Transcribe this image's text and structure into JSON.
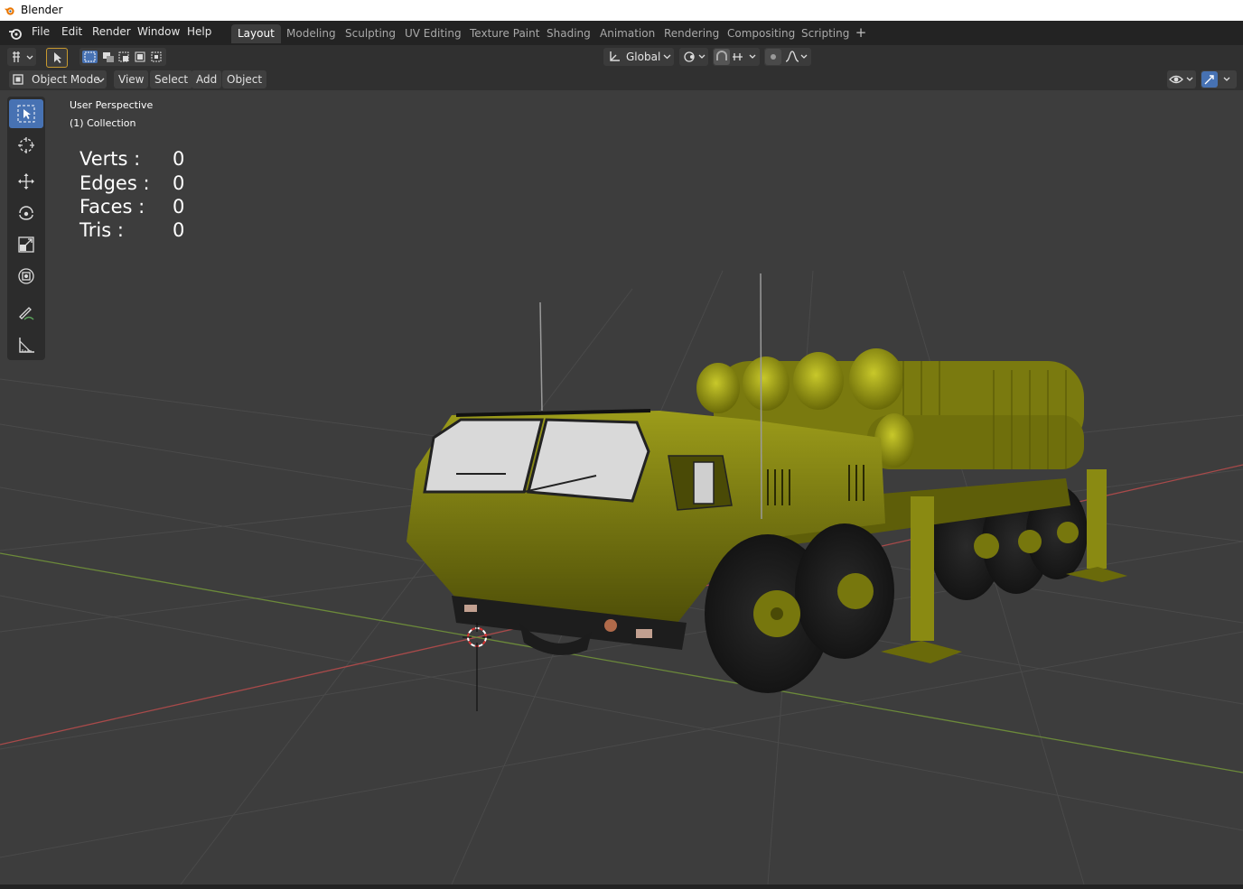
{
  "window": {
    "title": "Blender"
  },
  "menu": {
    "file": "File",
    "edit": "Edit",
    "render": "Render",
    "window": "Window",
    "help": "Help"
  },
  "workspaces": [
    "Layout",
    "Modeling",
    "Sculpting",
    "UV Editing",
    "Texture Paint",
    "Shading",
    "Animation",
    "Rendering",
    "Compositing",
    "Scripting"
  ],
  "active_workspace": "Layout",
  "header": {
    "orientation": "Global"
  },
  "viewport_header": {
    "mode": "Object Mode",
    "view": "View",
    "select": "Select",
    "add": "Add",
    "object": "Object"
  },
  "overlay": {
    "perspective": "User Perspective",
    "collection": "(1) Collection"
  },
  "stats": {
    "verts_label": "Verts :",
    "verts": "0",
    "edges_label": "Edges :",
    "edges": "0",
    "faces_label": "Faces :",
    "faces": "0",
    "tris_label": "Tris :",
    "tris": "0"
  },
  "colors": {
    "accent": "#4772b3",
    "model": "#8b8b12",
    "x_axis": "#a84a4a",
    "y_axis": "#6c8a3a"
  }
}
